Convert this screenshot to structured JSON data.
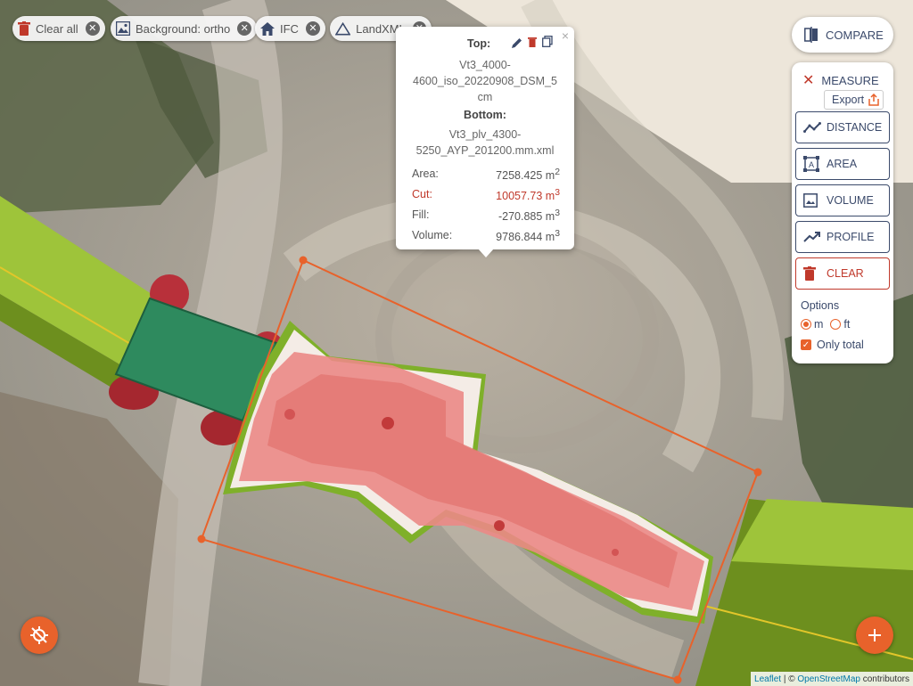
{
  "layer_chips": [
    {
      "label": "Clear all",
      "icon": "trash-icon"
    },
    {
      "label": "Background: ortho",
      "icon": "image-icon"
    },
    {
      "label": "IFC",
      "icon": "home-icon"
    },
    {
      "label": "LandXML",
      "icon": "triangle-icon"
    }
  ],
  "popup": {
    "top_label": "Top:",
    "top_name_lines": [
      "Vt3_4000-",
      "4600_iso_20220908_DSM_5",
      "cm"
    ],
    "bottom_label": "Bottom:",
    "bottom_name_lines": [
      "Vt3_plv_4300-",
      "5250_AYP_201200.mm.xml"
    ],
    "close": "×",
    "rows": [
      {
        "label": "Area:",
        "value": "7258.425 m",
        "exp": "2"
      },
      {
        "label": "Cut:",
        "value": "10057.73 m",
        "exp": "3"
      },
      {
        "label": "Fill:",
        "value": "-270.885 m",
        "exp": "3"
      },
      {
        "label": "Volume:",
        "value": "9786.844 m",
        "exp": "3"
      }
    ]
  },
  "compare": {
    "label": "COMPARE"
  },
  "measure": {
    "title": "MEASURE",
    "export_label": "Export",
    "tools": [
      {
        "label": "DISTANCE",
        "icon": "distance-icon"
      },
      {
        "label": "AREA",
        "icon": "area-icon"
      },
      {
        "label": "VOLUME",
        "icon": "volume-icon"
      },
      {
        "label": "PROFILE",
        "icon": "profile-icon"
      },
      {
        "label": "CLEAR",
        "icon": "trash-icon"
      }
    ],
    "options_label": "Options",
    "unit_m": "m",
    "unit_ft": "ft",
    "selected_unit": "m",
    "only_total_label": "Only total",
    "only_total_checked": true
  },
  "attribution": {
    "leaflet": "Leaflet",
    "sep": " | © ",
    "osm": "OpenStreetMap",
    "suffix": " contributors"
  },
  "colors": {
    "accent": "#e8622b",
    "navy": "#3b4a6b",
    "cut_red": "#c0392b"
  }
}
